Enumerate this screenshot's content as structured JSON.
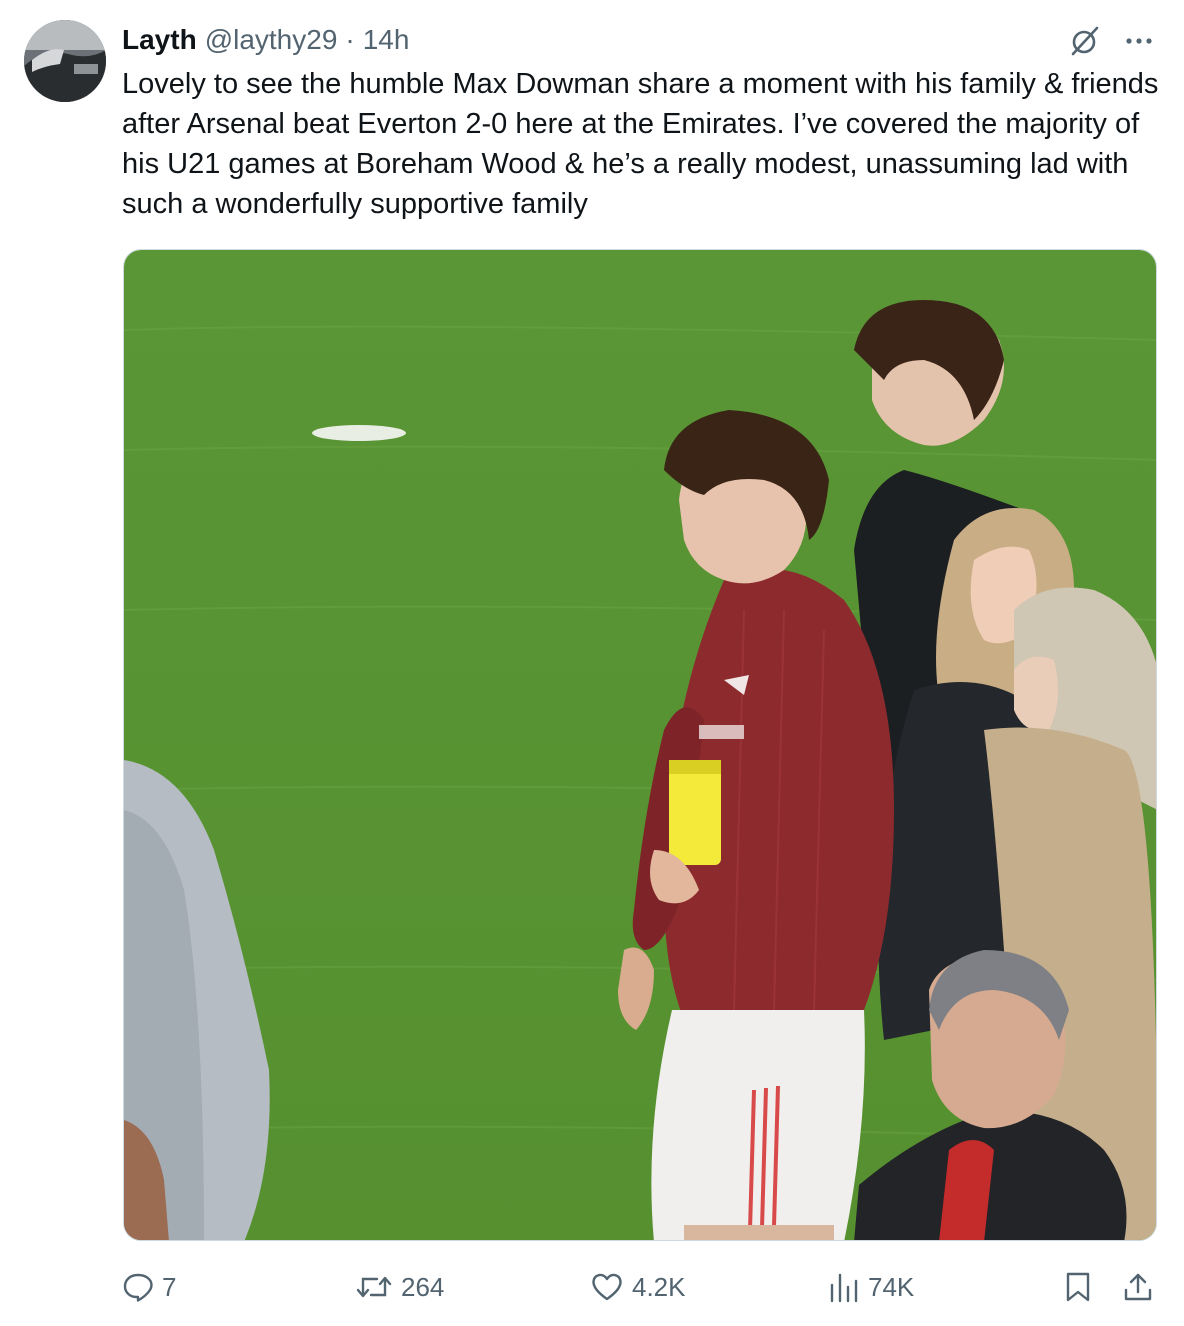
{
  "tweet": {
    "author_name": "Layth",
    "author_handle": "@laythy29",
    "separator": "·",
    "time": "14h",
    "text": "Lovely to see the humble Max Dowman share a moment with his family & friends after Arsenal beat Everton 2-0 here at the Emirates. I’ve covered the majority of his U21 games at Boreham Wood & he’s a really modest, unassuming lad with such a wonderfully supportive family"
  },
  "top_icons": {
    "grok": "grok-icon",
    "more": "more-options-icon"
  },
  "media": {
    "type": "photo",
    "colors": {
      "pitch": "#5f9a3a",
      "shirt": "#8c2a2e"
    }
  },
  "actions": {
    "replies": "7",
    "reposts": "264",
    "likes": "4.2K",
    "views": "74K"
  },
  "colors": {
    "text": "#0f1419",
    "secondary": "#536471",
    "border": "#cfd9de"
  }
}
